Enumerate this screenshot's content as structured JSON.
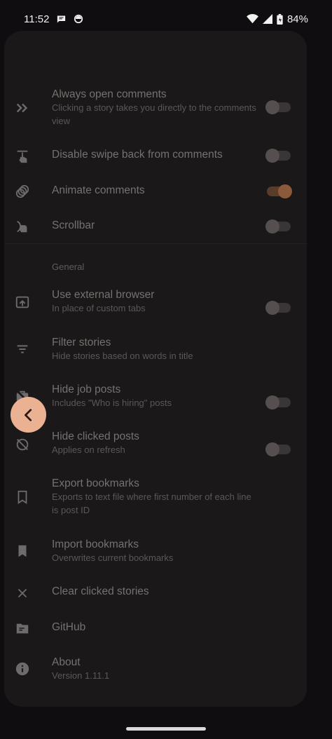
{
  "status_bar": {
    "time": "11:52",
    "battery_percent": "84%",
    "left_icons": [
      "message-bubble-icon",
      "sync-circle-icon"
    ],
    "right_icons": [
      "wifi-icon",
      "cell-signal-icon",
      "battery-icon"
    ]
  },
  "settings": {
    "comments": [
      {
        "id": "always-open-comments",
        "title": "Always open comments",
        "subtitle": "Clicking a story takes you directly to the comments view",
        "icon": "double-chevron-right-icon",
        "toggle": true,
        "on": false
      },
      {
        "id": "disable-swipe-back",
        "title": "Disable swipe back from comments",
        "subtitle": "",
        "icon": "swipe-gesture-icon",
        "toggle": true,
        "on": false
      },
      {
        "id": "animate-comments",
        "title": "Animate comments",
        "subtitle": "",
        "icon": "animation-icon",
        "toggle": true,
        "on": true
      },
      {
        "id": "scrollbar",
        "title": "Scrollbar",
        "subtitle": "",
        "icon": "swipe-vertical-icon",
        "toggle": true,
        "on": false
      }
    ],
    "general_header": "General",
    "general": [
      {
        "id": "use-external-browser",
        "title": "Use external browser",
        "subtitle": "In place of custom tabs",
        "icon": "open-in-browser-icon",
        "toggle": true,
        "on": false
      },
      {
        "id": "filter-stories",
        "title": "Filter stories",
        "subtitle": "Hide stories based on words in title",
        "icon": "filter-icon",
        "toggle": false
      },
      {
        "id": "hide-job-posts",
        "title": "Hide job posts",
        "subtitle": "Includes \"Who is hiring\" posts",
        "icon": "work-off-icon",
        "toggle": true,
        "on": false
      },
      {
        "id": "hide-clicked-posts",
        "title": "Hide clicked posts",
        "subtitle": "Applies on refresh",
        "icon": "visibility-off-icon",
        "toggle": true,
        "on": false
      },
      {
        "id": "export-bookmarks",
        "title": "Export bookmarks",
        "subtitle": "Exports to text file where first number of each line is post ID",
        "icon": "bookmark-outline-icon",
        "toggle": false
      },
      {
        "id": "import-bookmarks",
        "title": "Import bookmarks",
        "subtitle": "Overwrites current bookmarks",
        "icon": "bookmark-filled-icon",
        "toggle": false
      },
      {
        "id": "clear-clicked-stories",
        "title": "Clear clicked stories",
        "subtitle": "",
        "icon": "close-icon",
        "toggle": false
      },
      {
        "id": "github",
        "title": "GitHub",
        "subtitle": "",
        "icon": "folder-icon",
        "toggle": false
      },
      {
        "id": "about",
        "title": "About",
        "subtitle": "Version 1.11.1",
        "icon": "info-icon",
        "toggle": false
      }
    ]
  },
  "back_button": {
    "icon": "chevron-left-icon",
    "color": "#eab293"
  },
  "colors": {
    "background": "#0f0d0f",
    "sheet": "#1b1819",
    "accent": "#eab293"
  }
}
